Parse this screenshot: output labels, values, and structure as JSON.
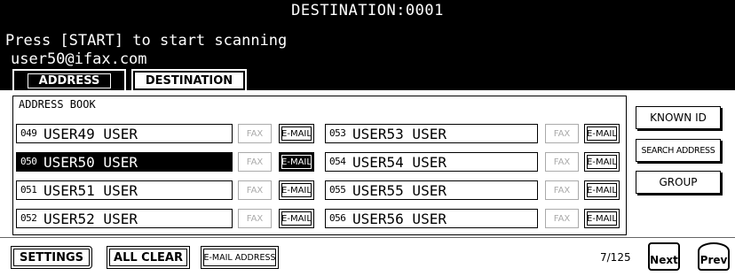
{
  "header": {
    "title": "DESTINATION:0001",
    "message": "Press [START] to start scanning",
    "address": "user50@ifax.com"
  },
  "tabs": {
    "address": "ADDRESS",
    "destination": "DESTINATION"
  },
  "address_book": {
    "title": "ADDRESS BOOK",
    "fax_label": "FAX",
    "email_label": "E-MAIL",
    "entries": [
      {
        "num": "049",
        "name": "USER49 USER",
        "selected": false
      },
      {
        "num": "050",
        "name": "USER50 USER",
        "selected": true
      },
      {
        "num": "051",
        "name": "USER51 USER",
        "selected": false
      },
      {
        "num": "052",
        "name": "USER52 USER",
        "selected": false
      },
      {
        "num": "053",
        "name": "USER53 USER",
        "selected": false
      },
      {
        "num": "054",
        "name": "USER54 USER",
        "selected": false
      },
      {
        "num": "055",
        "name": "USER55 USER",
        "selected": false
      },
      {
        "num": "056",
        "name": "USER56 USER",
        "selected": false
      }
    ]
  },
  "side_buttons": {
    "known_id": "KNOWN ID",
    "search_address": "SEARCH ADDRESS",
    "group": "GROUP"
  },
  "bottom": {
    "settings": "SETTINGS",
    "all_clear": "ALL CLEAR",
    "email_address": "E-MAIL ADDRESS",
    "page_indicator": "7/125",
    "next": "Next",
    "prev": "Prev"
  }
}
